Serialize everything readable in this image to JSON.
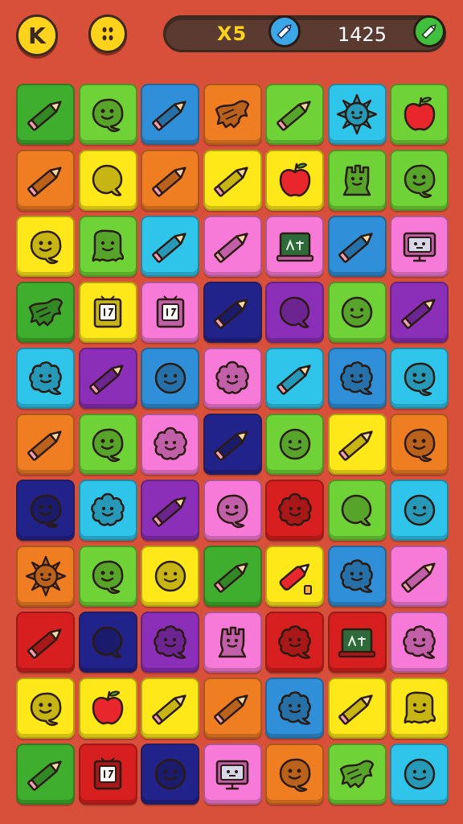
{
  "header": {
    "menu_button_label": "K",
    "multiplier_text": "X5",
    "score_text": "1425"
  },
  "board": {
    "rows": [
      [
        {
          "color": "#3fae2e",
          "icon": "pencil"
        },
        {
          "color": "#6fd236",
          "icon": "smiley-blob"
        },
        {
          "color": "#2f8fd8",
          "icon": "pencil"
        },
        {
          "color": "#ef7d22",
          "icon": "cloth"
        },
        {
          "color": "#6fd236",
          "icon": "pencil"
        },
        {
          "color": "#2fc4ea",
          "icon": "sun"
        },
        {
          "color": "#6fd236",
          "icon": "apple"
        }
      ],
      [
        {
          "color": "#ef7d22",
          "icon": "pencil"
        },
        {
          "color": "#ffe81a",
          "icon": "blob"
        },
        {
          "color": "#ef7d22",
          "icon": "pencil"
        },
        {
          "color": "#ffe81a",
          "icon": "pencil"
        },
        {
          "color": "#ffe81a",
          "icon": "apple"
        },
        {
          "color": "#6fd236",
          "icon": "creature"
        },
        {
          "color": "#6fd236",
          "icon": "smiley-blob"
        }
      ],
      [
        {
          "color": "#ffe81a",
          "icon": "smiley-blob"
        },
        {
          "color": "#6fd236",
          "icon": "ghost"
        },
        {
          "color": "#2fc4ea",
          "icon": "pencil"
        },
        {
          "color": "#f77ad8",
          "icon": "pencil"
        },
        {
          "color": "#f77ad8",
          "icon": "board"
        },
        {
          "color": "#2f8fd8",
          "icon": "pencil"
        },
        {
          "color": "#f77ad8",
          "icon": "monitor"
        }
      ],
      [
        {
          "color": "#3fae2e",
          "icon": "cloth"
        },
        {
          "color": "#ffe81a",
          "icon": "box"
        },
        {
          "color": "#f77ad8",
          "icon": "box"
        },
        {
          "color": "#22238a",
          "icon": "pencil"
        },
        {
          "color": "#8b2fb8",
          "icon": "blob"
        },
        {
          "color": "#6fd236",
          "icon": "face"
        },
        {
          "color": "#8b2fb8",
          "icon": "pencil"
        }
      ],
      [
        {
          "color": "#2fc4ea",
          "icon": "splat"
        },
        {
          "color": "#8b2fb8",
          "icon": "pencil"
        },
        {
          "color": "#2f8fd8",
          "icon": "face"
        },
        {
          "color": "#f77ad8",
          "icon": "flower"
        },
        {
          "color": "#2fc4ea",
          "icon": "pencil"
        },
        {
          "color": "#2f8fd8",
          "icon": "splat"
        },
        {
          "color": "#2fc4ea",
          "icon": "smiley-blob"
        }
      ],
      [
        {
          "color": "#ef7d22",
          "icon": "pencil"
        },
        {
          "color": "#6fd236",
          "icon": "smiley-blob"
        },
        {
          "color": "#f77ad8",
          "icon": "flower"
        },
        {
          "color": "#22238a",
          "icon": "pencil"
        },
        {
          "color": "#6fd236",
          "icon": "face"
        },
        {
          "color": "#ffe81a",
          "icon": "pencil"
        },
        {
          "color": "#ef7d22",
          "icon": "smiley-blob"
        }
      ],
      [
        {
          "color": "#22238a",
          "icon": "smiley-blob"
        },
        {
          "color": "#2fc4ea",
          "icon": "flower"
        },
        {
          "color": "#8b2fb8",
          "icon": "pencil"
        },
        {
          "color": "#f77ad8",
          "icon": "smiley-blob"
        },
        {
          "color": "#d81f1f",
          "icon": "flower"
        },
        {
          "color": "#6fd236",
          "icon": "blob"
        },
        {
          "color": "#2fc4ea",
          "icon": "face"
        }
      ],
      [
        {
          "color": "#ef7d22",
          "icon": "sun"
        },
        {
          "color": "#6fd236",
          "icon": "smiley-blob"
        },
        {
          "color": "#ffe81a",
          "icon": "face"
        },
        {
          "color": "#3fae2e",
          "icon": "pencil"
        },
        {
          "color": "#ffe81a",
          "icon": "marker"
        },
        {
          "color": "#2f8fd8",
          "icon": "splat"
        },
        {
          "color": "#f77ad8",
          "icon": "pencil"
        }
      ],
      [
        {
          "color": "#d81f1f",
          "icon": "pencil"
        },
        {
          "color": "#22238a",
          "icon": "blob"
        },
        {
          "color": "#8b2fb8",
          "icon": "splat"
        },
        {
          "color": "#f77ad8",
          "icon": "creature"
        },
        {
          "color": "#d81f1f",
          "icon": "splat"
        },
        {
          "color": "#d81f1f",
          "icon": "board"
        },
        {
          "color": "#f77ad8",
          "icon": "splat"
        }
      ],
      [
        {
          "color": "#ffe81a",
          "icon": "smiley-blob"
        },
        {
          "color": "#ffe81a",
          "icon": "apple"
        },
        {
          "color": "#ffe81a",
          "icon": "pencil"
        },
        {
          "color": "#ef7d22",
          "icon": "pencil"
        },
        {
          "color": "#2f8fd8",
          "icon": "splat"
        },
        {
          "color": "#ffe81a",
          "icon": "pencil"
        },
        {
          "color": "#ffe81a",
          "icon": "ghost"
        }
      ],
      [
        {
          "color": "#3fae2e",
          "icon": "pencil"
        },
        {
          "color": "#d81f1f",
          "icon": "box"
        },
        {
          "color": "#22238a",
          "icon": "face"
        },
        {
          "color": "#f77ad8",
          "icon": "monitor"
        },
        {
          "color": "#ef7d22",
          "icon": "smiley-blob"
        },
        {
          "color": "#6fd236",
          "icon": "cloth"
        },
        {
          "color": "#2fc4ea",
          "icon": "face"
        }
      ]
    ]
  }
}
